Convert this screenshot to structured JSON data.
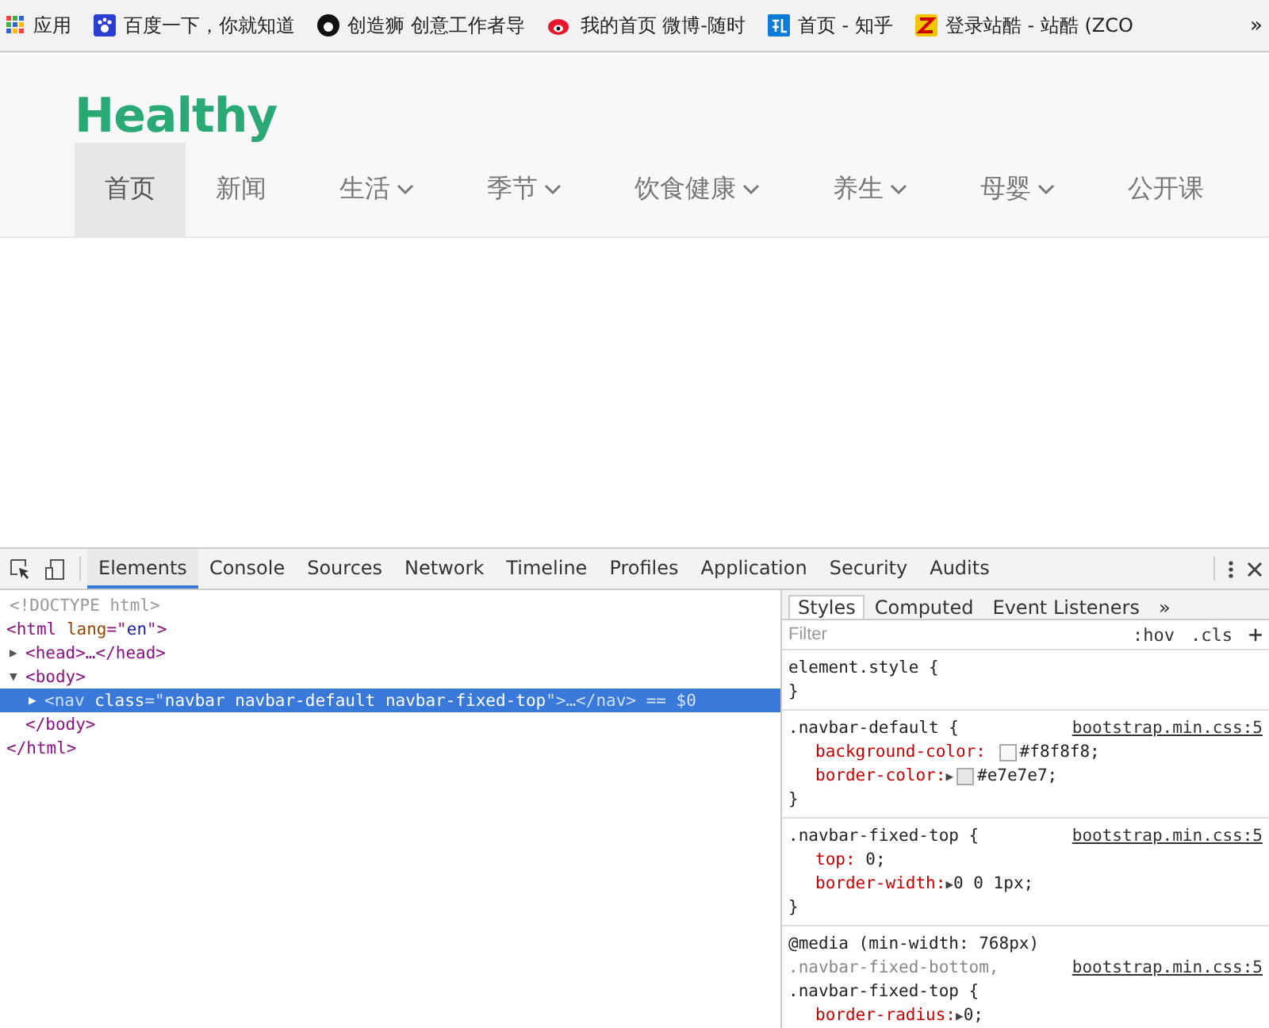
{
  "bookmarks": [
    {
      "label": "应用"
    },
    {
      "label": "百度一下，你就知道"
    },
    {
      "label": "创造狮 创意工作者导"
    },
    {
      "label": "我的首页 微博-随时"
    },
    {
      "label": "首页 - 知乎"
    },
    {
      "label": "登录站酷 - 站酷 (ZCO"
    }
  ],
  "bookmarks_more": "»",
  "site": {
    "logo": "Healthy",
    "nav": [
      {
        "label": "首页",
        "selected": true,
        "dropdown": false
      },
      {
        "label": "新闻",
        "selected": false,
        "dropdown": false
      },
      {
        "label": "生活",
        "selected": false,
        "dropdown": true
      },
      {
        "label": "季节",
        "selected": false,
        "dropdown": true
      },
      {
        "label": "饮食健康",
        "selected": false,
        "dropdown": true
      },
      {
        "label": "养生",
        "selected": false,
        "dropdown": true
      },
      {
        "label": "母婴",
        "selected": false,
        "dropdown": true
      },
      {
        "label": "公开课",
        "selected": false,
        "dropdown": false
      }
    ]
  },
  "devtools": {
    "tabs": [
      {
        "label": "Elements",
        "selected": true
      },
      {
        "label": "Console",
        "selected": false
      },
      {
        "label": "Sources",
        "selected": false
      },
      {
        "label": "Network",
        "selected": false
      },
      {
        "label": "Timeline",
        "selected": false
      },
      {
        "label": "Profiles",
        "selected": false
      },
      {
        "label": "Application",
        "selected": false
      },
      {
        "label": "Security",
        "selected": false
      },
      {
        "label": "Audits",
        "selected": false
      }
    ],
    "dom": [
      {
        "kind": "doctype",
        "text": "<!DOCTYPE html>"
      },
      {
        "kind": "element",
        "selected": false,
        "tokens": [
          {
            "kind": "tag",
            "text": "<html "
          },
          {
            "kind": "attr",
            "text": "lang"
          },
          {
            "kind": "tag",
            "text": "=\""
          },
          {
            "kind": "value",
            "text": "en"
          },
          {
            "kind": "tag",
            "text": "\">"
          }
        ],
        "close": "</html>",
        "children": [
          {
            "kind": "element",
            "selected": false,
            "toggle": "▶",
            "tokens": [
              {
                "kind": "tag",
                "text": "<head>…</head>"
              }
            ]
          },
          {
            "kind": "element",
            "selected": false,
            "toggle": "▼",
            "tokens": [
              {
                "kind": "tag",
                "text": "<body>"
              }
            ],
            "close": "</body>",
            "children": [
              {
                "kind": "element",
                "selected": true,
                "toggle": "▶",
                "tokens": [
                  {
                    "kind": "tag",
                    "text": "<nav "
                  },
                  {
                    "kind": "attr",
                    "text": "class"
                  },
                  {
                    "kind": "tag",
                    "text": "=\""
                  },
                  {
                    "kind": "value",
                    "text": "navbar navbar-default navbar-fixed-top"
                  },
                  {
                    "kind": "tag",
                    "text": "\">…</nav>"
                  }
                ],
                "suffix": "== $0"
              }
            ]
          }
        ]
      }
    ],
    "side_tabs": [
      {
        "label": "Styles",
        "selected": true
      },
      {
        "label": "Computed",
        "selected": false
      },
      {
        "label": "Event Listeners",
        "selected": false
      }
    ],
    "side_more": "»",
    "filter": {
      "placeholder": "Filter",
      "hov": ":hov",
      "cls": ".cls",
      "add": "+"
    },
    "rules": [
      {
        "selectors": [
          {
            "text": "element.style {",
            "matched": true
          }
        ],
        "close": "}"
      },
      {
        "selectors": [
          {
            "text": ".navbar-default {",
            "matched": true
          }
        ],
        "source": "bootstrap.min.css:5",
        "declarations": [
          {
            "property": "background-color:",
            "value": "#f8f8f8;",
            "color": "#f8f8f8"
          },
          {
            "property": "border-color:",
            "arrow": "▶",
            "value": "#e7e7e7;",
            "color": "#e7e7e7"
          }
        ],
        "close": "}"
      },
      {
        "selectors": [
          {
            "text": ".navbar-fixed-top {",
            "matched": true
          }
        ],
        "source": "bootstrap.min.css:5",
        "declarations": [
          {
            "property": "top:",
            "value": "0;"
          },
          {
            "property": "border-width:",
            "arrow": "▶",
            "value": "0 0 1px;"
          }
        ],
        "close": "}"
      },
      {
        "media": "@media (min-width: 768px)",
        "selectors": [
          {
            "text": ".navbar-fixed-bottom,",
            "matched": false
          },
          {
            "text": ".navbar-fixed-top {",
            "matched": true
          }
        ],
        "source": "bootstrap.min.css:5",
        "declarations": [
          {
            "property": "border-radius:",
            "arrow": "▶",
            "value": "0;"
          }
        ]
      }
    ]
  }
}
